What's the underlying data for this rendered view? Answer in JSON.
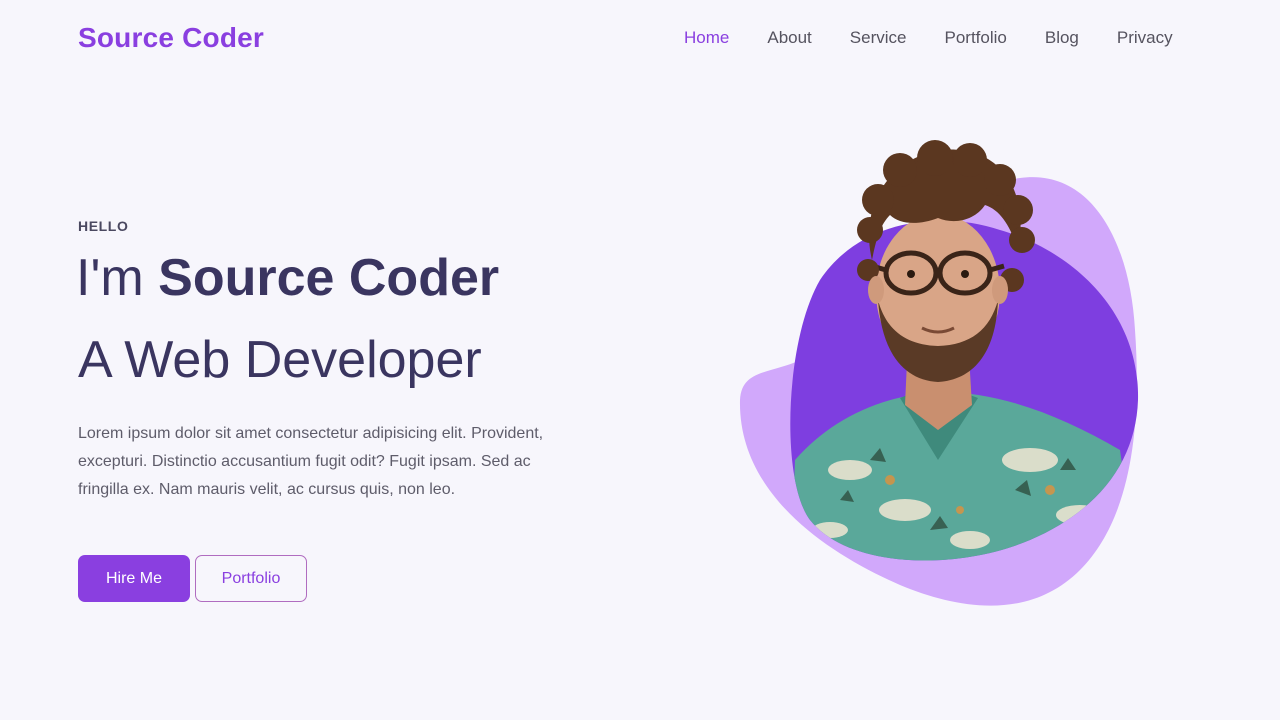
{
  "header": {
    "logo": "Source Coder",
    "nav": [
      {
        "label": "Home",
        "active": true
      },
      {
        "label": "About",
        "active": false
      },
      {
        "label": "Service",
        "active": false
      },
      {
        "label": "Portfolio",
        "active": false
      },
      {
        "label": "Blog",
        "active": false
      },
      {
        "label": "Privacy",
        "active": false
      }
    ]
  },
  "hero": {
    "eyebrow": "HELLO",
    "title_prefix": "I'm ",
    "title_name": "Source Coder",
    "subtitle": "A Web Developer",
    "description": "Lorem ipsum dolor sit amet consectetur adipisicing elit. Provident, excepturi. Distinctio accusantium fugit odit? Fugit ipsam. Sed ac fringilla ex. Nam mauris velit, ac cursus quis, non leo.",
    "buttons": {
      "primary": "Hire Me",
      "secondary": "Portfolio"
    }
  },
  "colors": {
    "accent": "#8a3fe0",
    "accent_light": "#d1a8fb",
    "heading": "#3a3560",
    "background": "#f7f6fc"
  },
  "image": {
    "subject": "portrait-photo"
  }
}
